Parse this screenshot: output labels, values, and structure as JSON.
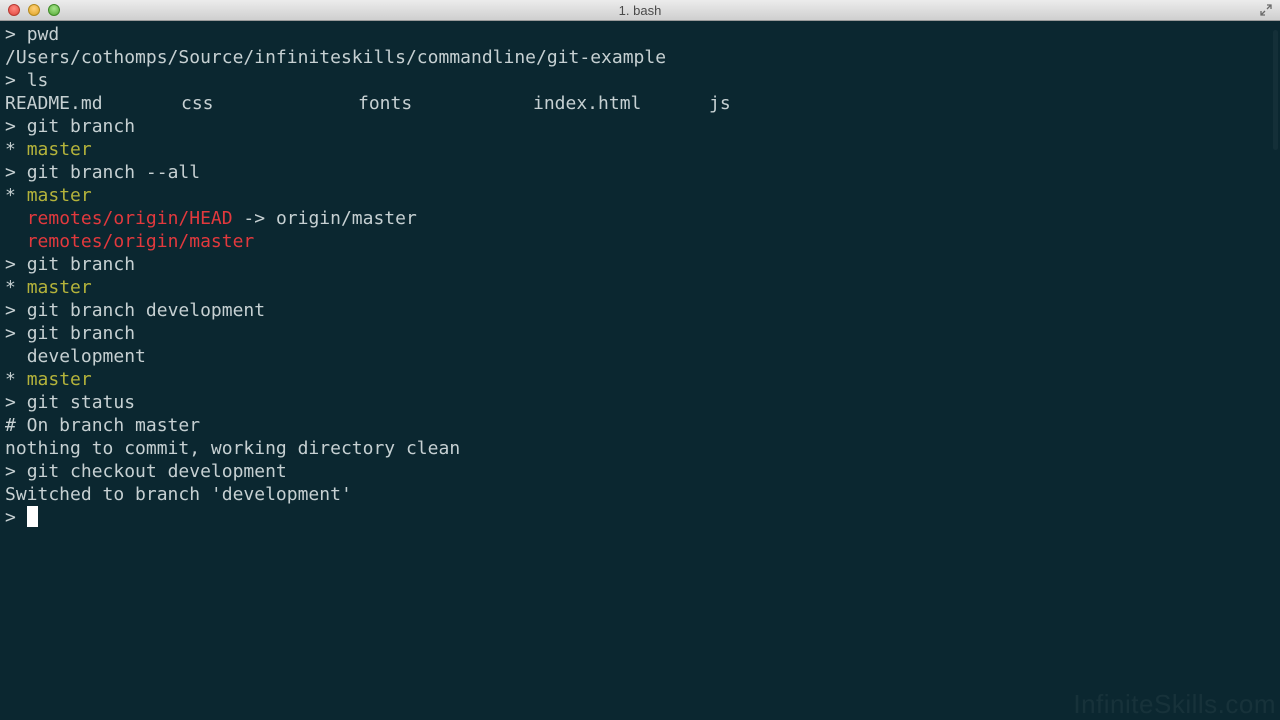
{
  "window": {
    "title": "1. bash"
  },
  "terminal": {
    "prompt": ">",
    "lines": {
      "l1_cmd": "pwd",
      "l2_out": "/Users/cothomps/Source/infiniteskills/commandline/git-example",
      "l3_cmd": "ls",
      "ls": [
        "README.md",
        "css",
        "fonts",
        "index.html",
        "js"
      ],
      "l5_cmd": "git branch",
      "l6_star": "*",
      "l6_branch": "master",
      "l7_cmd": "git branch --all",
      "l8_star": "*",
      "l8_branch": "master",
      "l9_remote": "remotes/origin/HEAD",
      "l9_arrow": " -> origin/master",
      "l10_remote": "remotes/origin/master",
      "l11_cmd": "git branch",
      "l12_star": "*",
      "l12_branch": "master",
      "l13_cmd": "git branch development",
      "l14_cmd": "git branch",
      "l15_branch": "development",
      "l16_star": "*",
      "l16_branch": "master",
      "l17_cmd": "git status",
      "l18_out": "# On branch master",
      "l19_out": "nothing to commit, working directory clean",
      "l20_cmd": "git checkout development",
      "l21_out": "Switched to branch 'development'"
    }
  },
  "watermark": "InfiniteSkills.com",
  "colors": {
    "background": "#0b2730",
    "foreground": "#c6d0d2",
    "branch_current": "#b4b33b",
    "remote_branch": "#e2393d"
  }
}
